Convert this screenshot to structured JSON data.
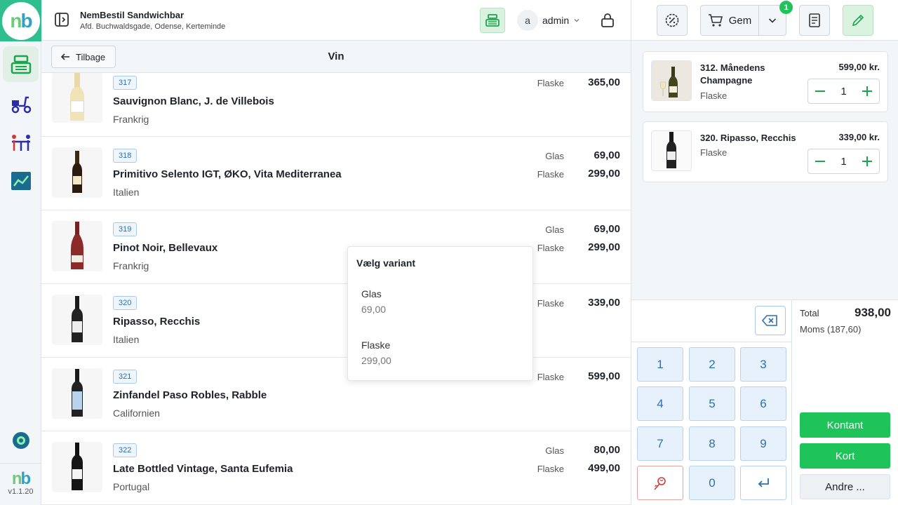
{
  "rail": {
    "logo": "nb",
    "version": "v1.1.20"
  },
  "header": {
    "store_name": "NemBestil Sandwichbar",
    "store_address": "Afd. Buchwaldsgade, Odense, Kerteminde",
    "avatar_letter": "a",
    "user_name": "admin"
  },
  "subheader": {
    "back_label": "Tilbage",
    "title": "Vin"
  },
  "products": [
    {
      "number": "317",
      "name": "Sauvignon Blanc, J. de Villebois",
      "origin": "Frankrig",
      "variants": [
        {
          "label": "Flaske",
          "price": "365,00"
        }
      ]
    },
    {
      "number": "318",
      "name": "Primitivo Selento IGT, ØKO, Vita Mediterranea",
      "origin": "Italien",
      "variants": [
        {
          "label": "Glas",
          "price": "69,00"
        },
        {
          "label": "Flaske",
          "price": "299,00"
        }
      ]
    },
    {
      "number": "319",
      "name": "Pinot Noir, Bellevaux",
      "origin": "Frankrig",
      "variants": [
        {
          "label": "Glas",
          "price": "69,00"
        },
        {
          "label": "Flaske",
          "price": "299,00"
        }
      ]
    },
    {
      "number": "320",
      "name": "Ripasso, Recchis",
      "origin": "Italien",
      "variants": [
        {
          "label": "Flaske",
          "price": "339,00"
        }
      ]
    },
    {
      "number": "321",
      "name": "Zinfandel Paso Robles, Rabble",
      "origin": "Californien",
      "variants": [
        {
          "label": "Flaske",
          "price": "599,00"
        }
      ]
    },
    {
      "number": "322",
      "name": "Late Bottled Vintage, Santa Eufemia",
      "origin": "Portugal",
      "variants": [
        {
          "label": "Glas",
          "price": "80,00"
        },
        {
          "label": "Flaske",
          "price": "499,00"
        }
      ]
    }
  ],
  "variant_popup": {
    "title": "Vælg variant",
    "options": [
      {
        "name": "Glas",
        "price": "69,00"
      },
      {
        "name": "Flaske",
        "price": "299,00"
      }
    ]
  },
  "toolbar": {
    "save_label": "Gem",
    "cart_count": "1"
  },
  "cart": [
    {
      "name": "312. Månedens Champagne",
      "price": "599,00 kr.",
      "variant": "Flaske",
      "qty": "1"
    },
    {
      "name": "320. Ripasso, Recchis",
      "price": "339,00 kr.",
      "variant": "Flaske",
      "qty": "1"
    }
  ],
  "numpad": {
    "keys": [
      "1",
      "2",
      "3",
      "4",
      "5",
      "6",
      "7",
      "8",
      "9",
      "0"
    ]
  },
  "totals": {
    "total_label": "Total",
    "total_value": "938,00",
    "moms": "Moms (187,60)",
    "cash_label": "Kontant",
    "card_label": "Kort",
    "other_label": "Andre ..."
  },
  "colors": {
    "accent_green": "#1ec35a",
    "accent_blue": "#2f6fb0",
    "brand_teal": "#2fbf8f"
  }
}
